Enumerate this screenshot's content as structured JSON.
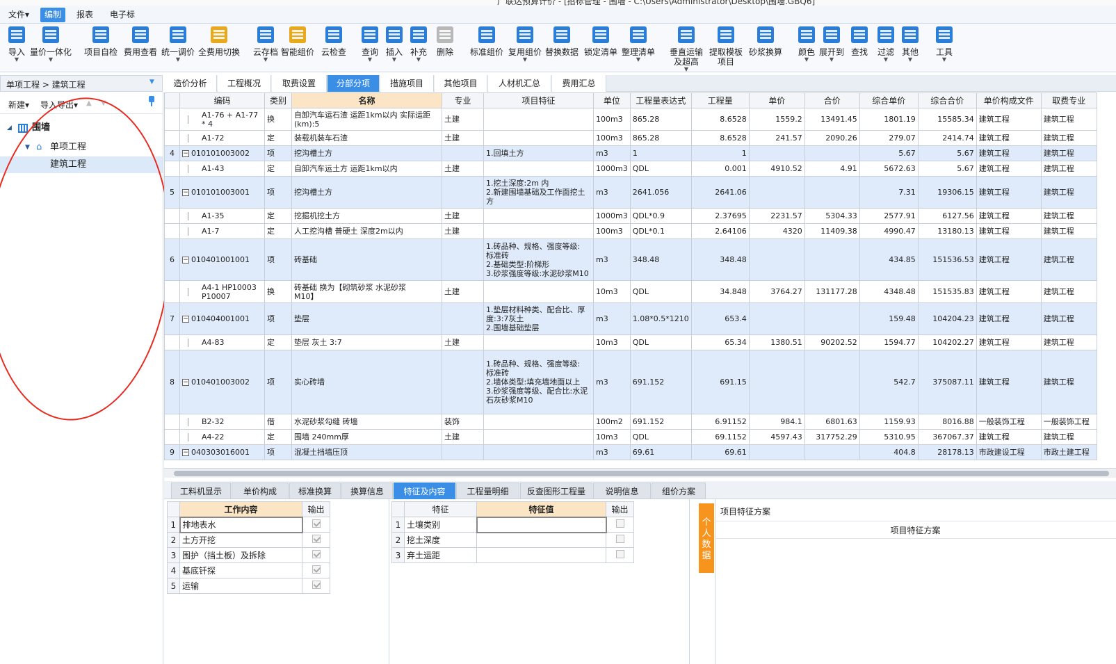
{
  "window": {
    "title": "广联达预算计价 - [招标管理 - 围墙 - C:\\Users\\Administrator\\Desktop\\围墙.GBQ6]"
  },
  "menu": [
    {
      "label": "文件▾",
      "active": false
    },
    {
      "label": "编制",
      "active": true
    },
    {
      "label": "报表",
      "active": false
    },
    {
      "label": "电子标",
      "active": false
    }
  ],
  "toolbar": [
    {
      "label": "导入",
      "color": "#2a7ed8",
      "dd": true
    },
    {
      "label": "量价一体化",
      "color": "#2a7ed8",
      "dd": true
    },
    {
      "label": "项目自检",
      "color": "#2a7ed8",
      "dd": false
    },
    {
      "label": "费用查看",
      "color": "#2a7ed8",
      "dd": false
    },
    {
      "label": "统一调价",
      "color": "#2a7ed8",
      "dd": true
    },
    {
      "label": "全费用切换",
      "color": "#e8a91c",
      "dd": false
    },
    {
      "label": "云存档",
      "color": "#2a7ed8",
      "dd": true
    },
    {
      "label": "智能组价",
      "color": "#e8a91c",
      "dd": false
    },
    {
      "label": "云检查",
      "color": "#2a7ed8",
      "dd": false
    },
    {
      "label": "查询",
      "color": "#2a7ed8",
      "dd": true
    },
    {
      "label": "插入",
      "color": "#2a7ed8",
      "dd": true
    },
    {
      "label": "补充",
      "color": "#2a7ed8",
      "dd": true
    },
    {
      "label": "删除",
      "color": "#b8b8b8",
      "dd": false
    },
    {
      "label": "标准组价",
      "color": "#2a7ed8",
      "dd": false
    },
    {
      "label": "复用组价",
      "color": "#2a7ed8",
      "dd": true
    },
    {
      "label": "替换数据",
      "color": "#2a7ed8",
      "dd": false
    },
    {
      "label": "锁定清单",
      "color": "#2a7ed8",
      "dd": false
    },
    {
      "label": "整理清单",
      "color": "#2a7ed8",
      "dd": true
    },
    {
      "label": "垂直运输\n及超高",
      "color": "#2a7ed8",
      "dd": true
    },
    {
      "label": "提取模板\n项目",
      "color": "#2a7ed8",
      "dd": false
    },
    {
      "label": "砂浆换算",
      "color": "#2a7ed8",
      "dd": false
    },
    {
      "label": "颜色",
      "color": "#2a7ed8",
      "dd": true
    },
    {
      "label": "展开到",
      "color": "#2a7ed8",
      "dd": true
    },
    {
      "label": "查找",
      "color": "#2a7ed8",
      "dd": false
    },
    {
      "label": "过滤",
      "color": "#2a7ed8",
      "dd": true
    },
    {
      "label": "其他",
      "color": "#2a7ed8",
      "dd": true
    },
    {
      "label": "工具",
      "color": "#2a7ed8",
      "dd": true
    }
  ],
  "breadcrumb": "单项工程 > 建筑工程",
  "left_tools": {
    "new": "新建▾",
    "import_export": "导入导出▾",
    "up": "▲",
    "down": "▼"
  },
  "tree": [
    {
      "label": "围墙",
      "level": 0
    },
    {
      "label": "单项工程",
      "level": 1
    },
    {
      "label": "建筑工程",
      "level": 2,
      "selected": true
    }
  ],
  "tabs": [
    "造价分析",
    "工程概况",
    "取费设置",
    "分部分项",
    "措施项目",
    "其他项目",
    "人材机汇总",
    "费用汇总"
  ],
  "active_tab": 3,
  "columns": [
    "",
    "编码",
    "类别",
    "名称",
    "专业",
    "项目特征",
    "单位",
    "工程量表达式",
    "工程量",
    "单价",
    "合价",
    "综合单价",
    "综合合价",
    "单价构成文件",
    "取费专业"
  ],
  "highlight_column": 3,
  "rows": [
    {
      "type": "sub",
      "h": 32,
      "cells": [
        "",
        "A1-76 + A1-77\n* 4",
        "换",
        "自卸汽车运石渣 运距1km以内  实际运距\n(km):5",
        "土建",
        "",
        "100m3",
        "865.28",
        "8.6528",
        "1559.2",
        "13491.45",
        "1801.19",
        "15585.34",
        "建筑工程",
        "建筑工程"
      ]
    },
    {
      "type": "sub",
      "h": 22,
      "cells": [
        "",
        "A1-72",
        "定",
        "装载机装车石渣",
        "土建",
        "",
        "100m3",
        "865.28",
        "8.6528",
        "241.57",
        "2090.26",
        "279.07",
        "2414.74",
        "建筑工程",
        "建筑工程"
      ]
    },
    {
      "type": "item",
      "h": 22,
      "cells": [
        "4",
        "010101003002",
        "项",
        "挖沟槽土方",
        "",
        "1.回填土方",
        "m3",
        "1",
        "1",
        "",
        "",
        "5.67",
        "5.67",
        "建筑工程",
        "建筑工程"
      ]
    },
    {
      "type": "sub",
      "h": 22,
      "cells": [
        "",
        "A1-43",
        "定",
        "自卸汽车运土方 运距1km以内",
        "土建",
        "",
        "1000m3",
        "QDL",
        "0.001",
        "4910.52",
        "4.91",
        "5672.63",
        "5.67",
        "建筑工程",
        "建筑工程"
      ]
    },
    {
      "type": "item",
      "h": 46,
      "cells": [
        "5",
        "010101003001",
        "项",
        "挖沟槽土方",
        "",
        "1.挖土深度:2m 内\n2.新建围墙基础及工作面挖土方",
        "m3",
        "2641.056",
        "2641.06",
        "",
        "",
        "7.31",
        "19306.15",
        "建筑工程",
        "建筑工程"
      ]
    },
    {
      "type": "sub",
      "h": 22,
      "cells": [
        "",
        "A1-35",
        "定",
        "挖掘机挖土方",
        "土建",
        "",
        "1000m3",
        "QDL*0.9",
        "2.37695",
        "2231.57",
        "5304.33",
        "2577.91",
        "6127.56",
        "建筑工程",
        "建筑工程"
      ]
    },
    {
      "type": "sub",
      "h": 22,
      "cells": [
        "",
        "A1-7",
        "定",
        "人工挖沟槽 普硬土 深度2m以内",
        "土建",
        "",
        "100m3",
        "QDL*0.1",
        "2.64106",
        "4320",
        "11409.38",
        "4990.47",
        "13180.13",
        "建筑工程",
        "建筑工程"
      ]
    },
    {
      "type": "item",
      "h": 60,
      "cells": [
        "6",
        "010401001001",
        "项",
        "砖基础",
        "",
        "1.砖品种、规格、强度等级:\n标准砖\n2.基础类型:阶梯形\n3.砂浆强度等级:水泥砂浆M10",
        "m3",
        "348.48",
        "348.48",
        "",
        "",
        "434.85",
        "151536.53",
        "建筑工程",
        "建筑工程"
      ]
    },
    {
      "type": "sub",
      "h": 32,
      "cells": [
        "",
        "A4-1 HP10003\nP10007",
        "换",
        "砖基础  换为【砌筑砂浆 水泥砂浆\nM10】",
        "土建",
        "",
        "10m3",
        "QDL",
        "34.848",
        "3764.27",
        "131177.28",
        "4348.48",
        "151535.83",
        "建筑工程",
        "建筑工程"
      ]
    },
    {
      "type": "item",
      "h": 46,
      "cells": [
        "7",
        "010404001001",
        "项",
        "垫层",
        "",
        "1.垫层材料种类、配合比、厚度:3:7灰土\n2.围墙基础垫层",
        "m3",
        "1.08*0.5*1210",
        "653.4",
        "",
        "",
        "159.48",
        "104204.23",
        "建筑工程",
        "建筑工程"
      ]
    },
    {
      "type": "sub",
      "h": 22,
      "cells": [
        "",
        "A4-83",
        "定",
        "垫层 灰土 3:7",
        "土建",
        "",
        "10m3",
        "QDL",
        "65.34",
        "1380.51",
        "90202.52",
        "1594.77",
        "104202.27",
        "建筑工程",
        "建筑工程"
      ]
    },
    {
      "type": "item",
      "h": 92,
      "cells": [
        "8",
        "010401003002",
        "项",
        "实心砖墙",
        "",
        "1.砖品种、规格、强度等级:\n标准砖\n2.墙体类型:填充墙地面以上\n3.砂浆强度等级、配合比:水泥石灰砂浆M10",
        "m3",
        "691.152",
        "691.15",
        "",
        "",
        "542.7",
        "375087.11",
        "建筑工程",
        "建筑工程"
      ]
    },
    {
      "type": "sub",
      "h": 22,
      "cells": [
        "",
        "B2-32",
        "借",
        "水泥砂浆勾缝 砖墙",
        "装饰",
        "",
        "100m2",
        "691.152",
        "6.91152",
        "984.1",
        "6801.63",
        "1159.93",
        "8016.88",
        "一般装饰工程",
        "一般装饰工程"
      ]
    },
    {
      "type": "sub",
      "h": 22,
      "cells": [
        "",
        "A4-22",
        "定",
        "围墙 240mm厚",
        "土建",
        "",
        "10m3",
        "QDL",
        "69.1152",
        "4597.43",
        "317752.29",
        "5310.95",
        "367067.37",
        "建筑工程",
        "建筑工程"
      ]
    },
    {
      "type": "item",
      "h": 22,
      "cells": [
        "9",
        "040303016001",
        "项",
        "混凝土挡墙压顶",
        "",
        "",
        "m3",
        "69.61",
        "69.61",
        "",
        "",
        "404.8",
        "28178.13",
        "市政建设工程",
        "市政土建工程"
      ]
    }
  ],
  "bottom_tabs": [
    "工料机显示",
    "单价构成",
    "标准换算",
    "换算信息",
    "特征及内容",
    "工程量明细",
    "反查图形工程量",
    "说明信息",
    "组价方案"
  ],
  "active_bottom_tab": 4,
  "work_table": {
    "headers": [
      "",
      "工作内容",
      "输出"
    ],
    "rows": [
      {
        "n": "1",
        "label": "排地表水",
        "out": true
      },
      {
        "n": "2",
        "label": "土方开挖",
        "out": true
      },
      {
        "n": "3",
        "label": "围护（挡土板）及拆除",
        "out": true
      },
      {
        "n": "4",
        "label": "基底钎探",
        "out": true
      },
      {
        "n": "5",
        "label": "运输",
        "out": true
      }
    ]
  },
  "feature_table": {
    "headers": [
      "",
      "特征",
      "特征值",
      "输出"
    ],
    "rows": [
      {
        "n": "1",
        "label": "土壤类别",
        "value": "",
        "out": false
      },
      {
        "n": "2",
        "label": "挖土深度",
        "value": "",
        "out": false
      },
      {
        "n": "3",
        "label": "弃土运距",
        "value": "",
        "out": false
      }
    ]
  },
  "side_tab": "个人数据",
  "scheme": {
    "title": "项目特征方案",
    "header": "项目特征方案"
  }
}
